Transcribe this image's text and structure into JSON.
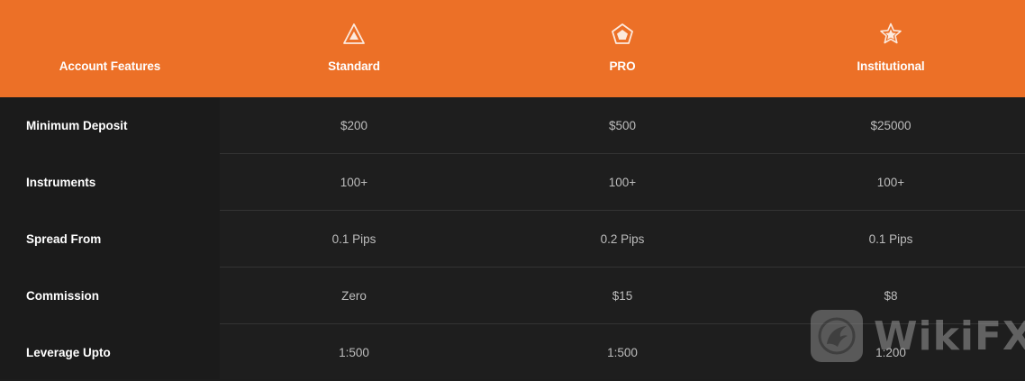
{
  "header": {
    "feature_label": "Account Features",
    "plans": [
      {
        "name": "Standard",
        "icon": "triangle-icon"
      },
      {
        "name": "PRO",
        "icon": "pentagon-icon"
      },
      {
        "name": "Institutional",
        "icon": "star-icon"
      }
    ]
  },
  "rows": [
    {
      "feature": "Minimum Deposit",
      "values": [
        "$200",
        "$500",
        "$25000"
      ]
    },
    {
      "feature": "Instruments",
      "values": [
        "100+",
        "100+",
        "100+"
      ]
    },
    {
      "feature": "Spread From",
      "values": [
        "0.1 Pips",
        "0.2 Pips",
        "0.1 Pips"
      ]
    },
    {
      "feature": "Commission",
      "values": [
        "Zero",
        "$15",
        "$8"
      ]
    },
    {
      "feature": "Leverage Upto",
      "values": [
        "1:500",
        "1:500",
        "1:200"
      ]
    }
  ],
  "watermark": {
    "text": "WikiFX",
    "icon": "wikifx-logo-icon"
  },
  "colors": {
    "header_bg": "#ec7027",
    "body_bg": "#1d1d1d",
    "feature_text": "#ffffff",
    "value_text": "#bdbdbd",
    "divider": "#333333"
  }
}
